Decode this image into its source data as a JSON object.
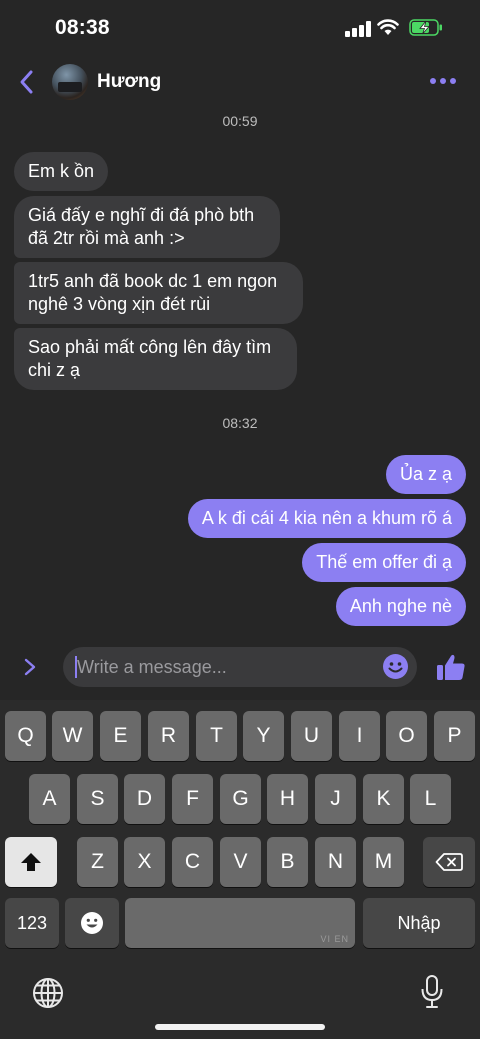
{
  "status_bar": {
    "time": "08:38"
  },
  "header": {
    "contact_name": "Hương"
  },
  "colors": {
    "accent": "#8c7ff2",
    "incoming_bubble": "#3b3b3d",
    "background": "#262626"
  },
  "timestamps": [
    "00:59",
    "08:32"
  ],
  "messages_in": [
    {
      "lines": [
        "Em k ồn"
      ]
    },
    {
      "lines": [
        "Giá đấy e nghĩ đi đá phò bth",
        "đã 2tr rồi mà anh :>"
      ]
    },
    {
      "lines": [
        "1tr5 anh đã book dc 1 em ngon",
        "nghê 3 vòng xịn đét rùi"
      ]
    },
    {
      "lines": [
        "Sao phải mất công lên đây tìm",
        "chi z ạ"
      ]
    }
  ],
  "messages_out": [
    {
      "text": "Ủa z ạ"
    },
    {
      "text": "A k đi cái 4 kia nên a khum rõ á"
    },
    {
      "text": "Thế em offer đi ạ"
    },
    {
      "text": "Anh nghe nè"
    }
  ],
  "composer": {
    "placeholder": "Write a message..."
  },
  "keyboard": {
    "row1": [
      "Q",
      "W",
      "E",
      "R",
      "T",
      "Y",
      "U",
      "I",
      "O",
      "P"
    ],
    "row2": [
      "A",
      "S",
      "D",
      "F",
      "G",
      "H",
      "J",
      "K",
      "L"
    ],
    "row3": [
      "Z",
      "X",
      "C",
      "V",
      "B",
      "N",
      "M"
    ],
    "numbers_key": "123",
    "return_key": "Nhập",
    "space_hint": "VI EN"
  },
  "icons": [
    "back-icon",
    "more-icon",
    "expand-icon",
    "emoji-icon",
    "thumbs-up-icon",
    "shift-icon",
    "delete-icon",
    "globe-icon",
    "microphone-icon",
    "emoji-keyboard-icon"
  ]
}
